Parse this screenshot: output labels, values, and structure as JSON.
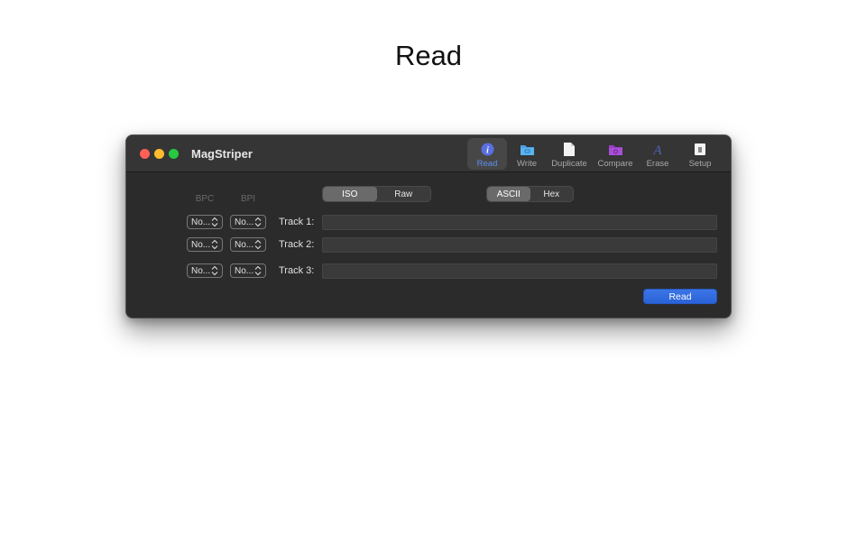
{
  "page": {
    "heading": "Read"
  },
  "window": {
    "title": "MagStriper",
    "toolbar": [
      {
        "label": "Read",
        "icon": "info-icon",
        "active": true
      },
      {
        "label": "Write",
        "icon": "folder-icon",
        "active": false
      },
      {
        "label": "Duplicate",
        "icon": "document-icon",
        "active": false
      },
      {
        "label": "Compare",
        "icon": "folder-compare-icon",
        "active": false
      },
      {
        "label": "Erase",
        "icon": "eraser-icon",
        "active": false
      },
      {
        "label": "Setup",
        "icon": "device-icon",
        "active": false
      }
    ]
  },
  "columns": {
    "bpc": "BPC",
    "bpi": "BPI"
  },
  "format_toggle": {
    "options": [
      "ISO",
      "Raw"
    ],
    "selected": "ISO"
  },
  "encoding_toggle": {
    "options": [
      "ASCII",
      "Hex"
    ],
    "selected": "ASCII"
  },
  "tracks": [
    {
      "label": "Track 1:",
      "bpc": "No...",
      "bpi": "No...",
      "value": ""
    },
    {
      "label": "Track 2:",
      "bpc": "No...",
      "bpi": "No...",
      "value": ""
    },
    {
      "label": "Track 3:",
      "bpc": "No...",
      "bpi": "No...",
      "value": ""
    }
  ],
  "actions": {
    "read_label": "Read"
  },
  "colors": {
    "accent": "#2f68dd",
    "window_bg": "#2b2b2b",
    "titlebar_bg": "#353535"
  }
}
